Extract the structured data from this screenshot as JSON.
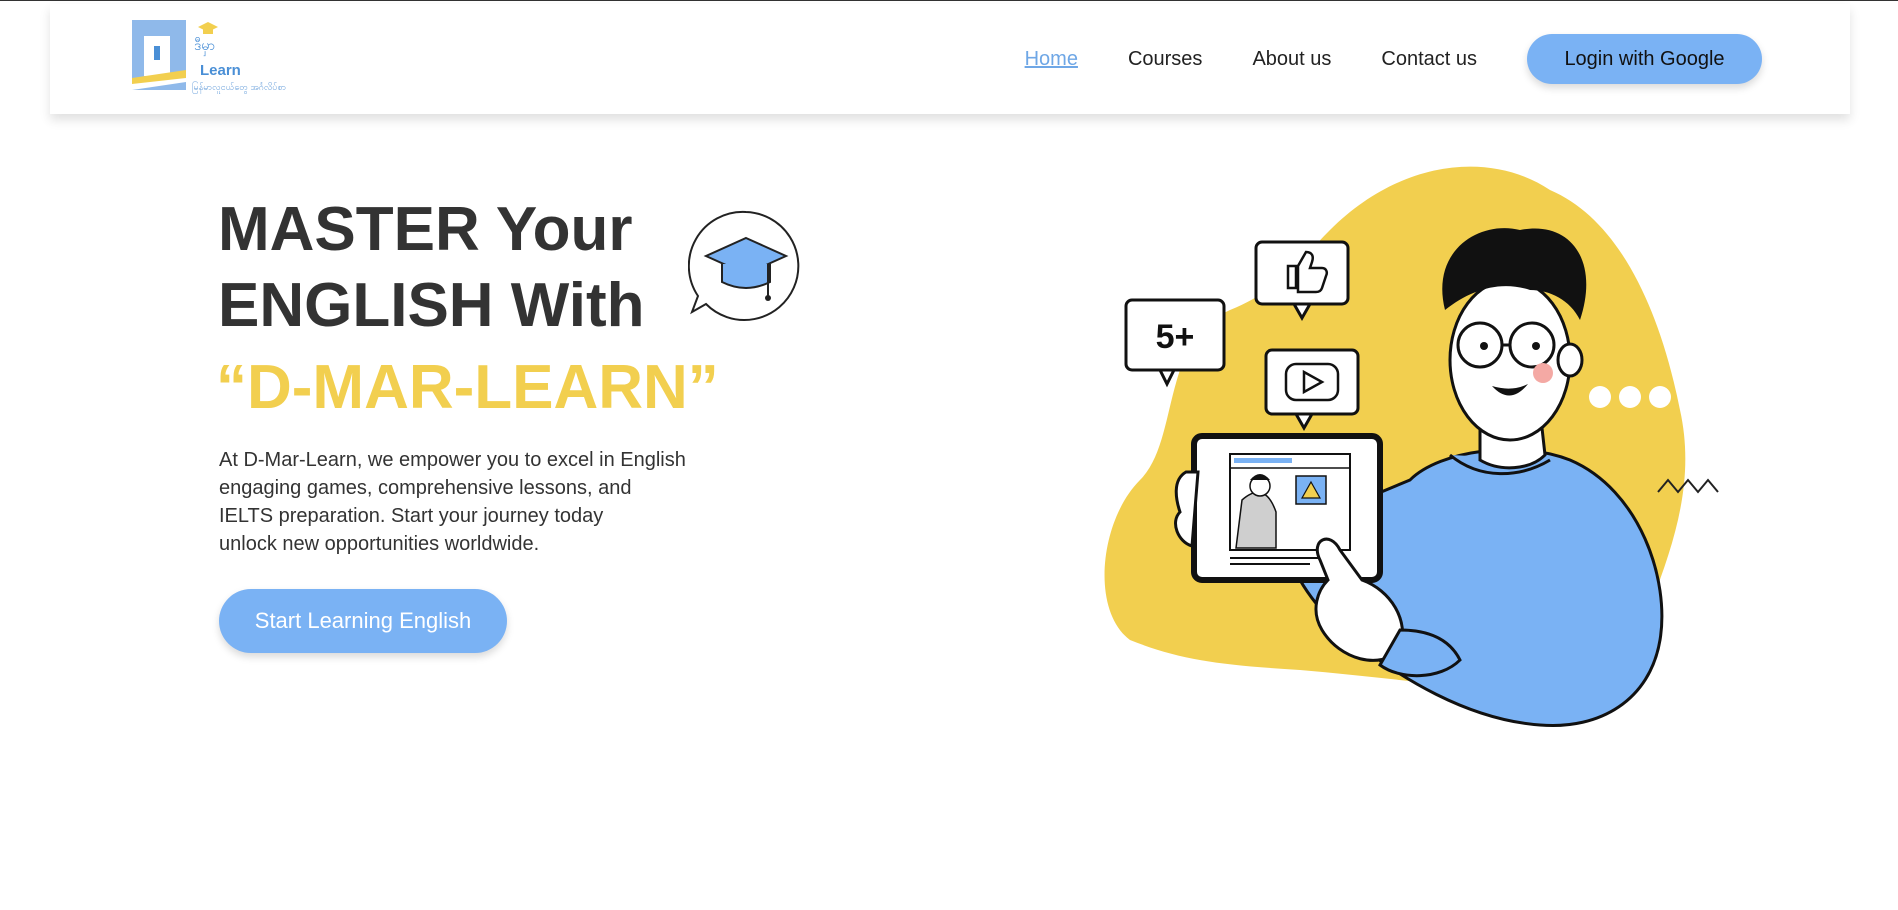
{
  "header": {
    "logo": {
      "brand_top": "ဒီမှာ",
      "brand_name": "Learn",
      "tagline": "မြန်မာလူငယ်တွေ အင်္ဂလိပ်စာ"
    },
    "nav": {
      "home": "Home",
      "courses": "Courses",
      "about": "About us",
      "contact": "Contact us"
    },
    "login_label": "Login with Google"
  },
  "hero": {
    "title_line1": "MASTER Your",
    "title_line2": "ENGLISH With",
    "brand": "“D-MAR-LEARN”",
    "description_lines": [
      "At D-Mar-Learn, we empower you to excel in English",
      "engaging games, comprehensive lessons, and",
      "IELTS preparation. Start your journey today",
      "unlock new opportunities worldwide."
    ],
    "cta_label": "Start Learning English"
  },
  "illustration": {
    "badge_text": "5+",
    "icons": [
      "graduation-cap-icon",
      "thumbs-up-icon",
      "play-icon"
    ]
  },
  "colors": {
    "accent_blue": "#7ab2f4",
    "brand_yellow": "#f2cf4f",
    "text_dark": "#333333"
  }
}
